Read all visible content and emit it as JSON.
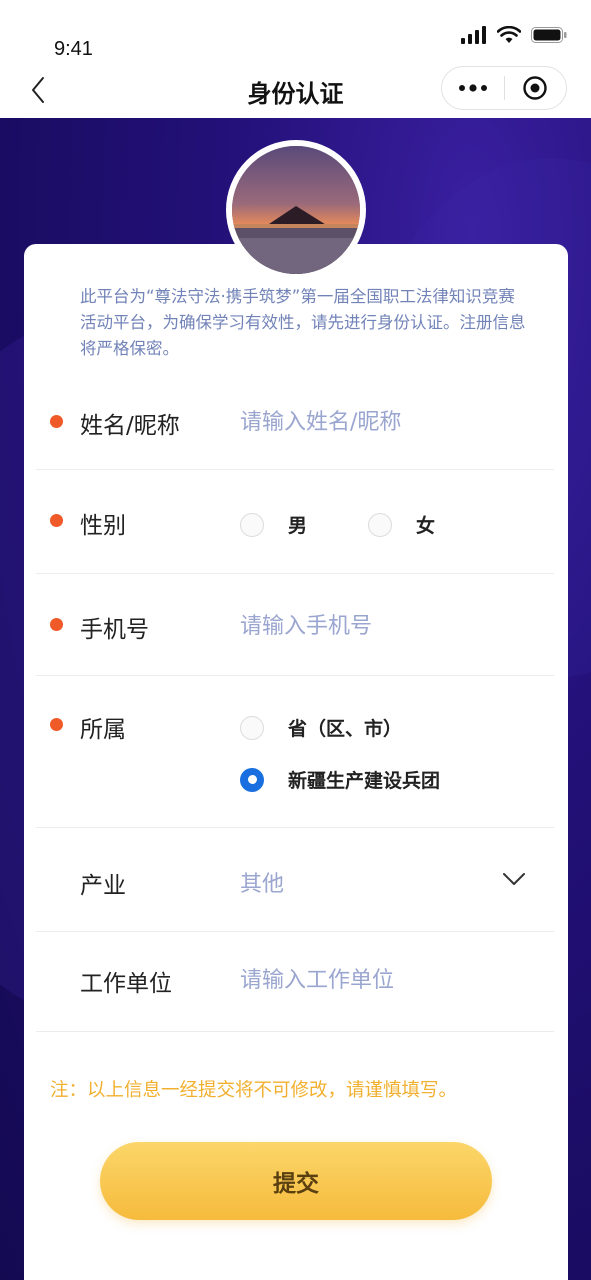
{
  "status_bar": {
    "time": "9:41"
  },
  "nav": {
    "title": "身份认证",
    "back_icon": "chevron-left-icon",
    "more_icon": "more-dots-icon",
    "close_icon": "target-circle-icon"
  },
  "intro": "此平台为“尊法守法·携手筑梦”第一届全国职工法律知识竞赛活动平台，为确保学习有效性，请先进行身份认证。注册信息将严格保密。",
  "form": {
    "name": {
      "label": "姓名/昵称",
      "placeholder": "请输入姓名/昵称",
      "value": "",
      "required": true
    },
    "gender": {
      "label": "性别",
      "options": [
        "男",
        "女"
      ],
      "selected": null,
      "required": true
    },
    "phone": {
      "label": "手机号",
      "placeholder": "请输入手机号",
      "value": "",
      "required": true
    },
    "affiliation": {
      "label": "所属",
      "options": [
        "省（区、市）",
        "新疆生产建设兵团"
      ],
      "selected": "新疆生产建设兵团",
      "required": true
    },
    "industry": {
      "label": "产业",
      "value": "其他",
      "required": false
    },
    "workplace": {
      "label": "工作单位",
      "placeholder": "请输入工作单位",
      "value": "",
      "required": false
    }
  },
  "note": "注：以上信息一经提交将不可修改，请谨慎填写。",
  "submit_label": "提交",
  "colors": {
    "required_dot": "#f05a28",
    "placeholder": "#9aa6cf",
    "note": "#f2b030",
    "radio_checked": "#1a6fe0",
    "bg": "#1a0c63"
  }
}
